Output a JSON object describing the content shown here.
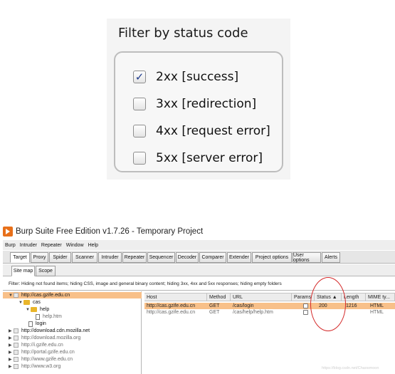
{
  "zoom": {
    "title": "Filter by status code",
    "options": [
      {
        "label": "2xx  [success]",
        "checked": true
      },
      {
        "label": "3xx  [redirection]",
        "checked": false
      },
      {
        "label": "4xx  [request error]",
        "checked": false
      },
      {
        "label": "5xx  [server error]",
        "checked": false
      }
    ]
  },
  "window": {
    "title": "Burp Suite Free Edition v1.7.26 - Temporary Project",
    "menu": [
      "Burp",
      "Intruder",
      "Repeater",
      "Window",
      "Help"
    ],
    "tabs": [
      "Target",
      "Proxy",
      "Spider",
      "Scanner",
      "Intruder",
      "Repeater",
      "Sequencer",
      "Decoder",
      "Comparer",
      "Extender",
      "Project options",
      "User options",
      "Alerts"
    ],
    "active_tab": "Target",
    "subtabs": [
      "Site map",
      "Scope"
    ],
    "active_subtab": "Site map",
    "filter": "Filter:  Hiding not found items;  hiding CSS, image and general binary content;  hiding 3xx, 4xx and 5xx responses;  hiding empty folders"
  },
  "tree": [
    {
      "label": "http://cas.gzife.edu.cn",
      "indent": 0,
      "twisty": "▼",
      "icon": "gpage",
      "selected": true,
      "dim": false
    },
    {
      "label": "cas",
      "indent": 1,
      "twisty": "▼",
      "icon": "folder",
      "selected": false,
      "dim": false
    },
    {
      "label": "help",
      "indent": 2,
      "twisty": "▼",
      "icon": "folder",
      "selected": false,
      "dim": false
    },
    {
      "label": "help.htm",
      "indent": 3,
      "twisty": "",
      "icon": "page",
      "selected": false,
      "dim": true
    },
    {
      "label": "login",
      "indent": 2,
      "twisty": "",
      "icon": "page",
      "selected": false,
      "dim": false
    },
    {
      "label": "http://download.cdn.mozilla.net",
      "indent": 0,
      "twisty": "▶",
      "icon": "gpage",
      "selected": false,
      "dim": false
    },
    {
      "label": "http://download.mozilla.org",
      "indent": 0,
      "twisty": "▶",
      "icon": "gpage",
      "selected": false,
      "dim": true
    },
    {
      "label": "http://i.gzife.edu.cn",
      "indent": 0,
      "twisty": "▶",
      "icon": "gpage",
      "selected": false,
      "dim": true
    },
    {
      "label": "http://portal.gzife.edu.cn",
      "indent": 0,
      "twisty": "▶",
      "icon": "gpage",
      "selected": false,
      "dim": true
    },
    {
      "label": "http://www.gzife.edu.cn",
      "indent": 0,
      "twisty": "▶",
      "icon": "gpage",
      "selected": false,
      "dim": true
    },
    {
      "label": "http://www.w3.org",
      "indent": 0,
      "twisty": "▶",
      "icon": "gpage",
      "selected": false,
      "dim": true
    }
  ],
  "table": {
    "columns": [
      "Host",
      "Method",
      "URL",
      "Params",
      "Status  ▲",
      "Length",
      "MIME ty..."
    ],
    "rows": [
      {
        "host": "http://cas.gzife.edu.cn",
        "method": "GET",
        "url": "/cas/login",
        "params": false,
        "status": "200",
        "length": "1216",
        "mime": "HTML",
        "selected": true
      },
      {
        "host": "http://cas.gzife.edu.cn",
        "method": "GET",
        "url": "/cas/help/help.htm",
        "params": false,
        "status": "",
        "length": "",
        "mime": "HTML",
        "selected": false
      }
    ]
  },
  "annotation_color": "#d42a2a",
  "selection_color": "#f8c089",
  "watermark": "https://blog.csdn.net/Chaosmoon"
}
